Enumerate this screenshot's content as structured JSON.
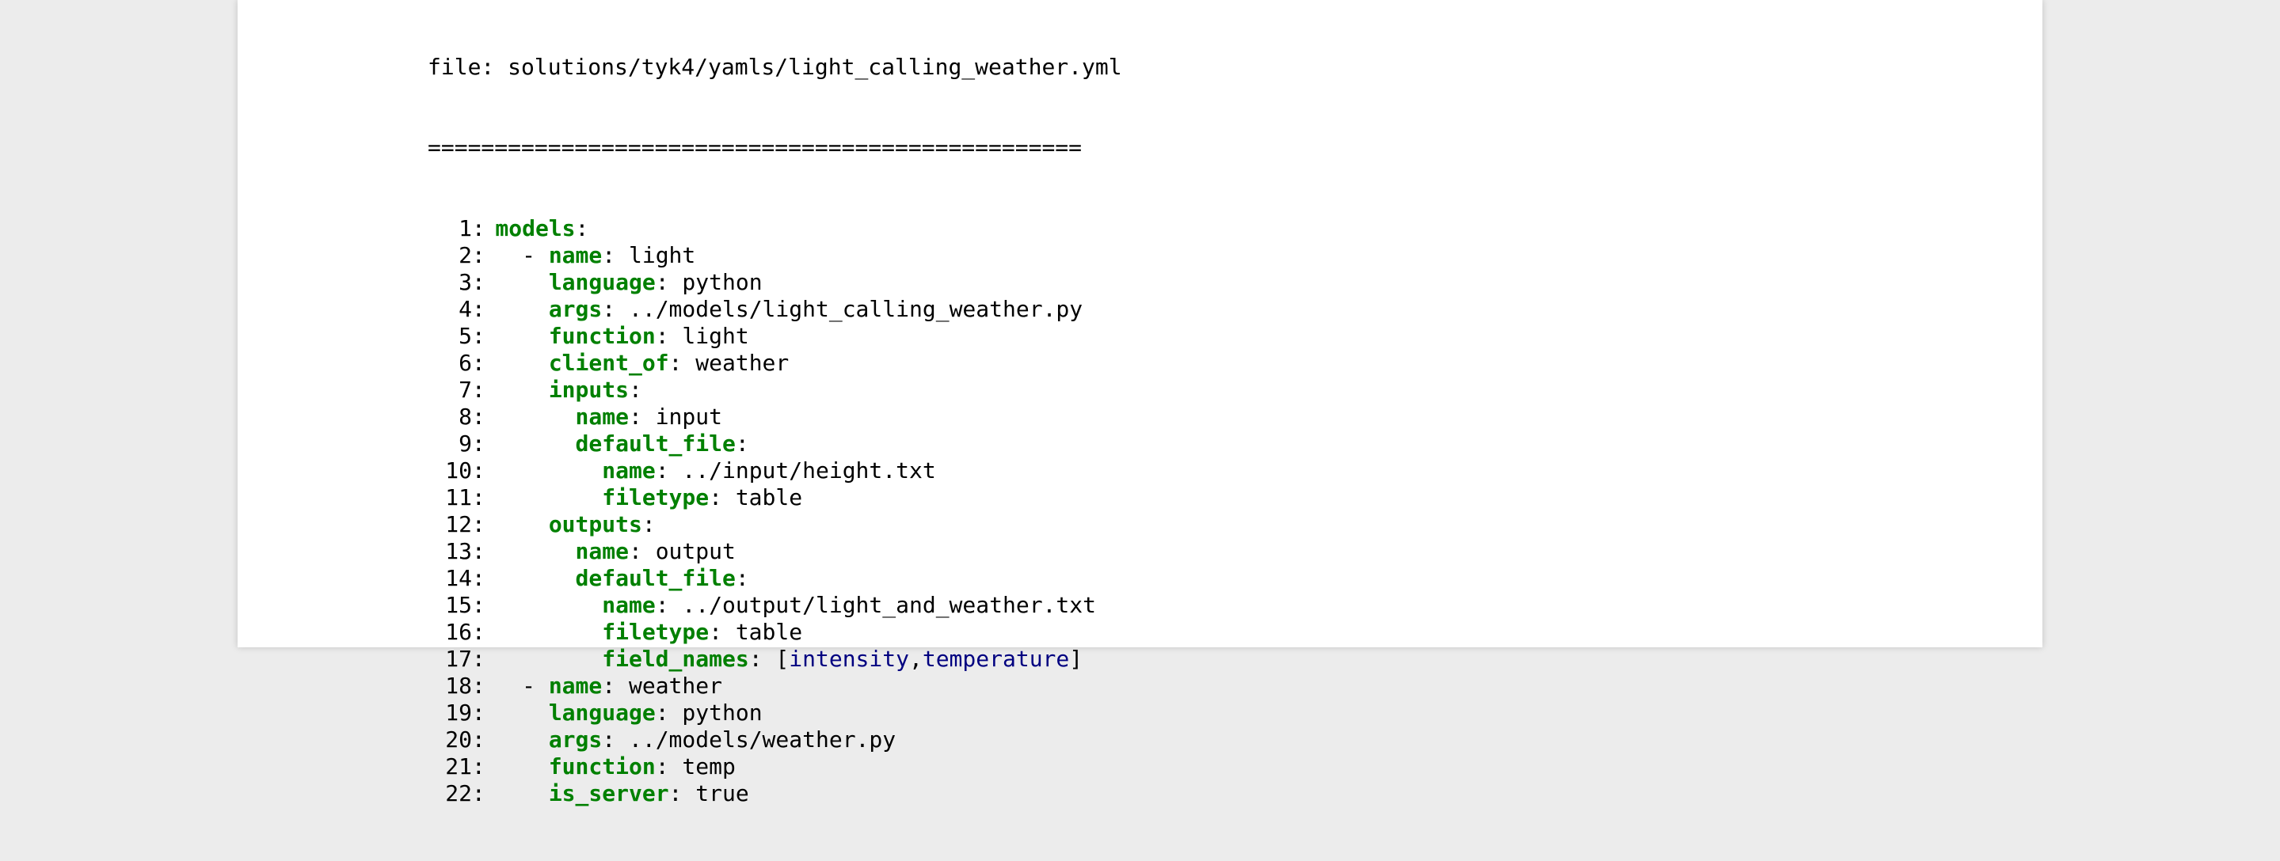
{
  "file_header": "file: solutions/tyk4/yamls/light_calling_weather.yml",
  "separator": "=================================================",
  "colors": {
    "key": "#008000",
    "list_value": "#000080",
    "text": "#000000",
    "page": "#ffffff",
    "background": "#ececec"
  },
  "code_lines": [
    {
      "num": "1:",
      "indent": 0,
      "dash": "",
      "key": "models",
      "sep": ":",
      "value": "",
      "list": []
    },
    {
      "num": "2:",
      "indent": 2,
      "dash": "- ",
      "key": "name",
      "sep": ": ",
      "value": "light",
      "list": []
    },
    {
      "num": "3:",
      "indent": 4,
      "dash": "",
      "key": "language",
      "sep": ": ",
      "value": "python",
      "list": []
    },
    {
      "num": "4:",
      "indent": 4,
      "dash": "",
      "key": "args",
      "sep": ": ",
      "value": "../models/light_calling_weather.py",
      "list": []
    },
    {
      "num": "5:",
      "indent": 4,
      "dash": "",
      "key": "function",
      "sep": ": ",
      "value": "light",
      "list": []
    },
    {
      "num": "6:",
      "indent": 4,
      "dash": "",
      "key": "client_of",
      "sep": ": ",
      "value": "weather",
      "list": []
    },
    {
      "num": "7:",
      "indent": 4,
      "dash": "",
      "key": "inputs",
      "sep": ":",
      "value": "",
      "list": []
    },
    {
      "num": "8:",
      "indent": 6,
      "dash": "",
      "key": "name",
      "sep": ": ",
      "value": "input",
      "list": []
    },
    {
      "num": "9:",
      "indent": 6,
      "dash": "",
      "key": "default_file",
      "sep": ":",
      "value": "",
      "list": []
    },
    {
      "num": "10:",
      "indent": 8,
      "dash": "",
      "key": "name",
      "sep": ": ",
      "value": "../input/height.txt",
      "list": []
    },
    {
      "num": "11:",
      "indent": 8,
      "dash": "",
      "key": "filetype",
      "sep": ": ",
      "value": "table",
      "list": []
    },
    {
      "num": "12:",
      "indent": 4,
      "dash": "",
      "key": "outputs",
      "sep": ":",
      "value": "",
      "list": []
    },
    {
      "num": "13:",
      "indent": 6,
      "dash": "",
      "key": "name",
      "sep": ": ",
      "value": "output",
      "list": []
    },
    {
      "num": "14:",
      "indent": 6,
      "dash": "",
      "key": "default_file",
      "sep": ":",
      "value": "",
      "list": []
    },
    {
      "num": "15:",
      "indent": 8,
      "dash": "",
      "key": "name",
      "sep": ": ",
      "value": "../output/light_and_weather.txt",
      "list": []
    },
    {
      "num": "16:",
      "indent": 8,
      "dash": "",
      "key": "filetype",
      "sep": ": ",
      "value": "table",
      "list": []
    },
    {
      "num": "17:",
      "indent": 8,
      "dash": "",
      "key": "field_names",
      "sep": ": ",
      "value": "",
      "list": [
        "intensity",
        "temperature"
      ]
    },
    {
      "num": "18:",
      "indent": 2,
      "dash": "- ",
      "key": "name",
      "sep": ": ",
      "value": "weather",
      "list": []
    },
    {
      "num": "19:",
      "indent": 4,
      "dash": "",
      "key": "language",
      "sep": ": ",
      "value": "python",
      "list": []
    },
    {
      "num": "20:",
      "indent": 4,
      "dash": "",
      "key": "args",
      "sep": ": ",
      "value": "../models/weather.py",
      "list": []
    },
    {
      "num": "21:",
      "indent": 4,
      "dash": "",
      "key": "function",
      "sep": ": ",
      "value": "temp",
      "list": []
    },
    {
      "num": "22:",
      "indent": 4,
      "dash": "",
      "key": "is_server",
      "sep": ": ",
      "value": "true",
      "list": []
    }
  ]
}
